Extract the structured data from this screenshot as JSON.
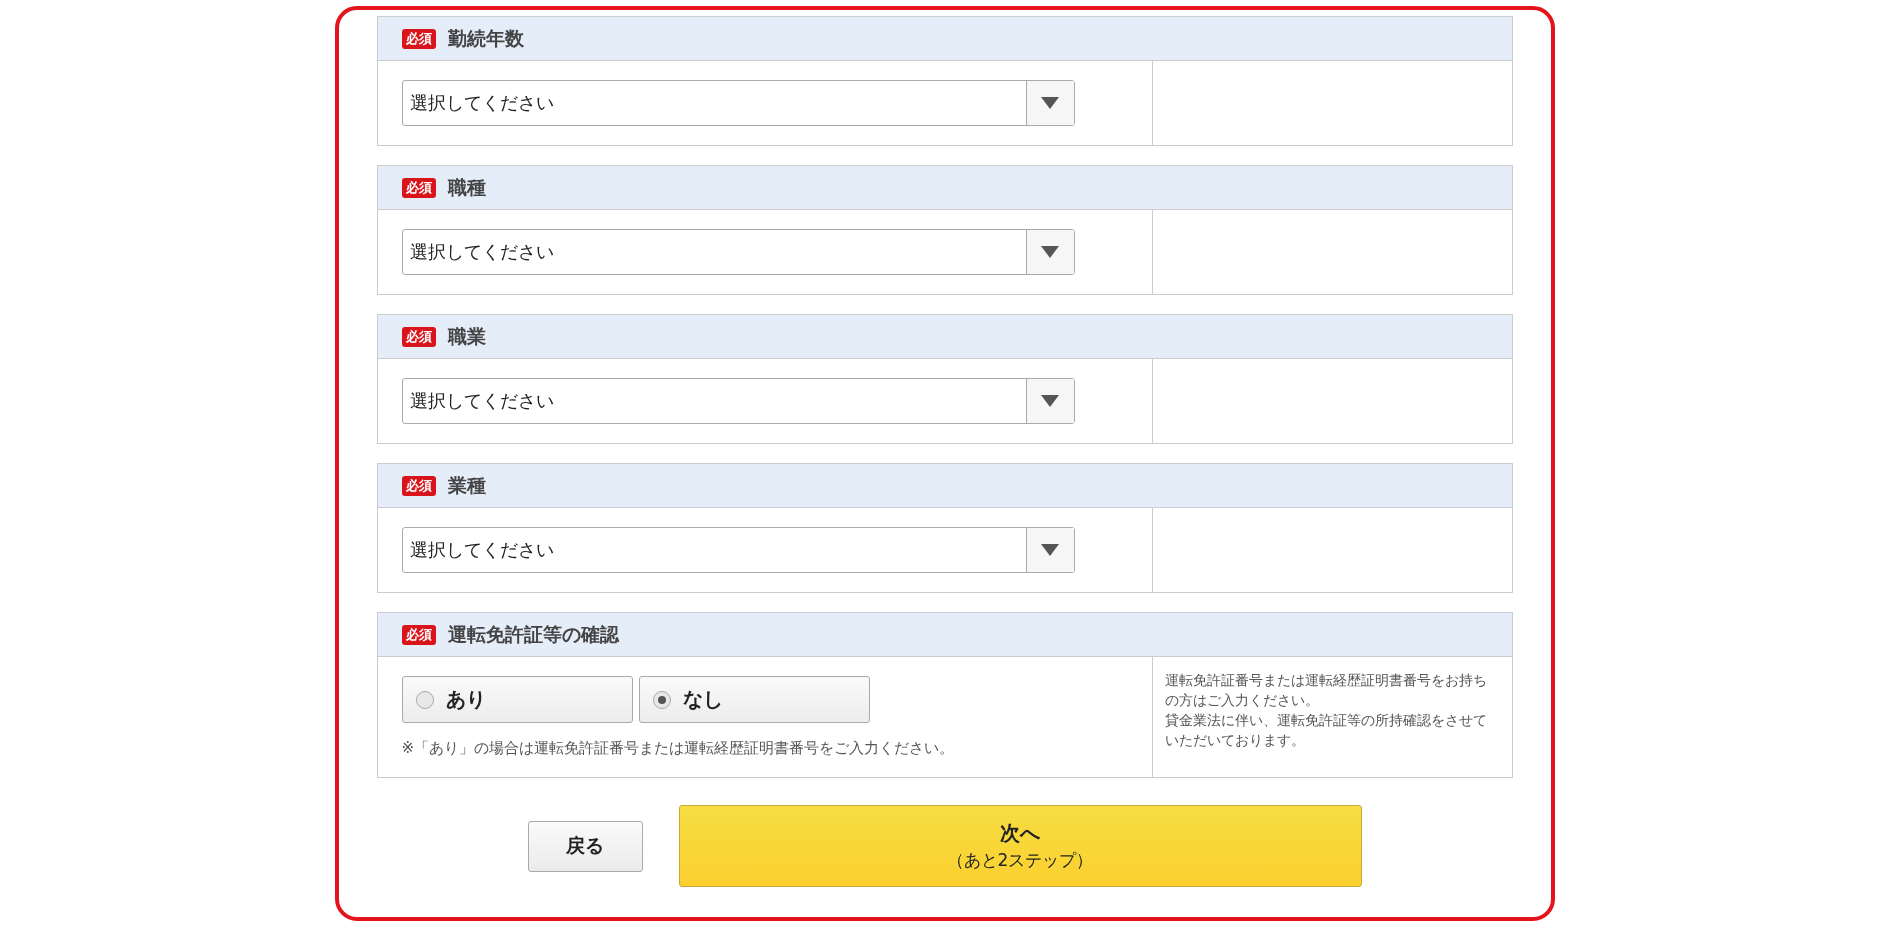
{
  "sections": [
    {
      "kind": "select",
      "badge": "必須",
      "title": "勤続年数",
      "placeholder": "選択してください"
    },
    {
      "kind": "select",
      "badge": "必須",
      "title": "職種",
      "placeholder": "選択してください"
    },
    {
      "kind": "select",
      "badge": "必須",
      "title": "職業",
      "placeholder": "選択してください"
    },
    {
      "kind": "select",
      "badge": "必須",
      "title": "業種",
      "placeholder": "選択してください"
    },
    {
      "kind": "radio",
      "badge": "必須",
      "title": "運転免許証等の確認",
      "options": [
        {
          "label": "あり",
          "selected": false
        },
        {
          "label": "なし",
          "selected": true
        }
      ],
      "note": "※「あり」の場合は運転免許証番号または運転経歴証明書番号をご入力ください。",
      "side_note": [
        "運転免許証番号または運転経歴証明書番号をお持ちの方はご入力ください。",
        "貸金業法に伴い、運転免許証等の所持確認をさせていただいております。"
      ]
    }
  ],
  "buttons": {
    "back": "戻る",
    "next": "次へ",
    "next_sub": "（あと2ステップ）"
  }
}
